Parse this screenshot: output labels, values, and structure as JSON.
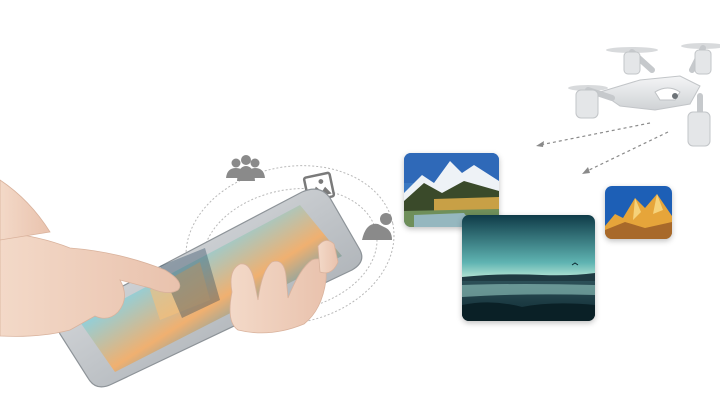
{
  "scene": {
    "icons": [
      "users-icon",
      "image-icon",
      "user-icon",
      "drone-icon"
    ],
    "photos": [
      "snowy-mountain-valley",
      "sunset-lake",
      "golden-peaks"
    ],
    "colors": {
      "background": "#ffffff",
      "icon_gray": "#8a8a8a",
      "tablet_frame": "#c9ccd0",
      "sky_teal": "#7fc4c8",
      "peak_gold": "#e6a53a"
    }
  }
}
